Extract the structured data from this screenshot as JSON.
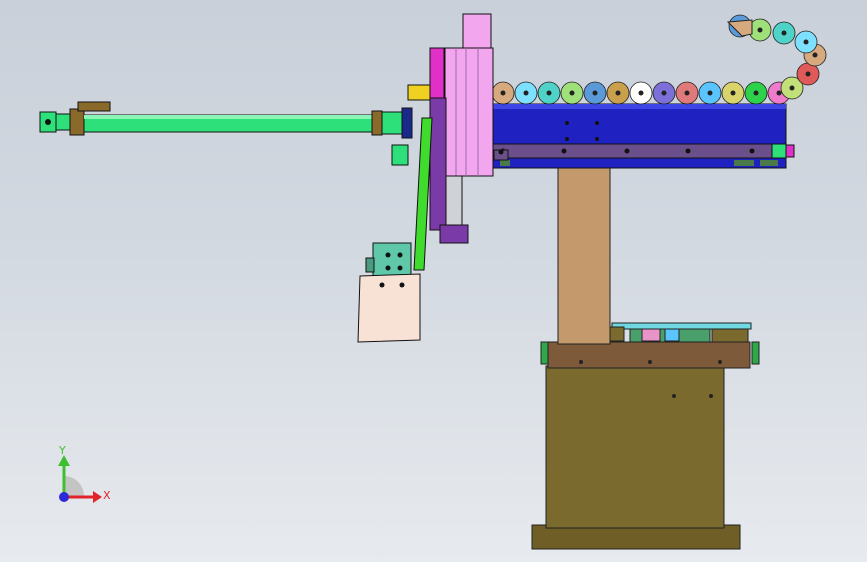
{
  "viewport": {
    "background_top": "#c9d0d9",
    "background_bottom": "#e7eaee"
  },
  "triad": {
    "y_label": "Y",
    "x_label": "X",
    "colors": {
      "x": "#e0242a",
      "y": "#3fbf2e",
      "z": "#2a2ad8"
    }
  },
  "palette": {
    "arm_green": "#2ee07a",
    "base_brown": "#7a6a2e",
    "column_tan": "#c49a6c",
    "rail_blue": "#1f22c0",
    "rail_purple": "#6b4f8a",
    "slider_pink": "#f2a6ee",
    "magenta_plate": "#e030c8",
    "gripper_green": "#5ec8a8",
    "gripper_plate": "#f8e2d6",
    "chain_colors": [
      "#d7a97e",
      "#7de0ff",
      "#4fd3c8",
      "#9fe07a",
      "#5a9ad8",
      "#c9a04c",
      "#ffffff",
      "#7d6fd8",
      "#e07a7a",
      "#5ac4ff",
      "#d8d36a",
      "#2ed24a",
      "#f07acb",
      "#c2e07a",
      "#e05a5a"
    ]
  }
}
